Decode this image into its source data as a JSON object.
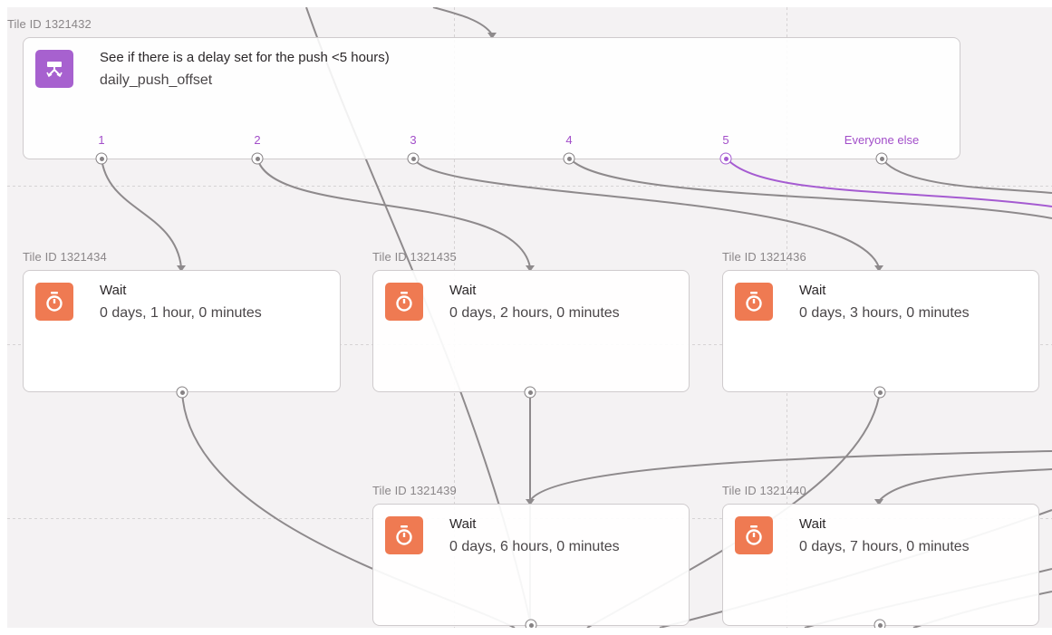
{
  "split_tile": {
    "tile_id": "Tile ID 1321432",
    "title": "See if there is a delay set for the push <5 hours)",
    "subtitle": "daily_push_offset",
    "icon": "split-branch-icon",
    "branches": [
      "1",
      "2",
      "3",
      "4",
      "5",
      "Everyone else"
    ],
    "color": "#a761cf"
  },
  "wait_tiles": [
    {
      "tile_id": "Tile ID 1321434",
      "title": "Wait",
      "detail": "0 days, 1 hour, 0 minutes"
    },
    {
      "tile_id": "Tile ID 1321435",
      "title": "Wait",
      "detail": "0 days, 2 hours, 0 minutes"
    },
    {
      "tile_id": "Tile ID 1321436",
      "title": "Wait",
      "detail": "0 days, 3 hours, 0 minutes"
    },
    {
      "tile_id": "Tile ID 1321439",
      "title": "Wait",
      "detail": "0 days, 6 hours, 0 minutes"
    },
    {
      "tile_id": "Tile ID 1321440",
      "title": "Wait",
      "detail": "0 days, 7 hours, 0 minutes"
    }
  ],
  "wait_icon": "stopwatch-icon",
  "colors": {
    "wait_accent": "#ef7a52",
    "connector": "#8e8a8c",
    "highlight_connector": "#a55bd1"
  }
}
